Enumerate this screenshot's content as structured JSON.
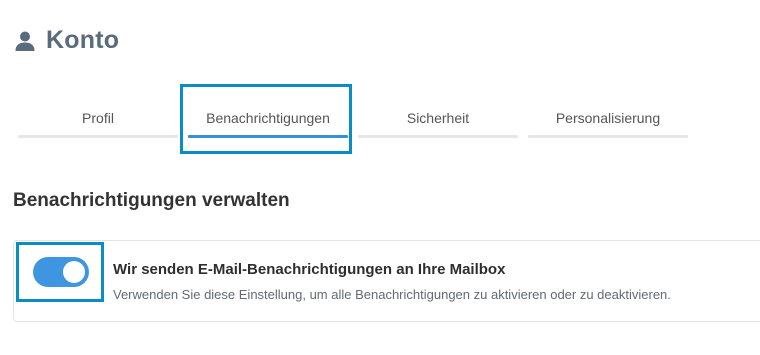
{
  "header": {
    "title": "Konto",
    "icon": "user-icon"
  },
  "tabs": [
    {
      "label": "Profil",
      "active": false
    },
    {
      "label": "Benachrichtigungen",
      "active": true
    },
    {
      "label": "Sicherheit",
      "active": false
    },
    {
      "label": "Personalisierung",
      "active": false
    }
  ],
  "section": {
    "title": "Benachrichtigungen verwalten"
  },
  "setting": {
    "title": "Wir senden E-Mail-Benachrichtigungen an Ihre Mailbox",
    "description": "Verwenden Sie diese Einstellung, um alle Benachrichtigungen zu aktivieren oder zu deaktivieren.",
    "enabled": true
  },
  "colors": {
    "accent": "#3f96e0",
    "focus_ring": "#0a8cc4",
    "title": "#5a6b7d"
  }
}
